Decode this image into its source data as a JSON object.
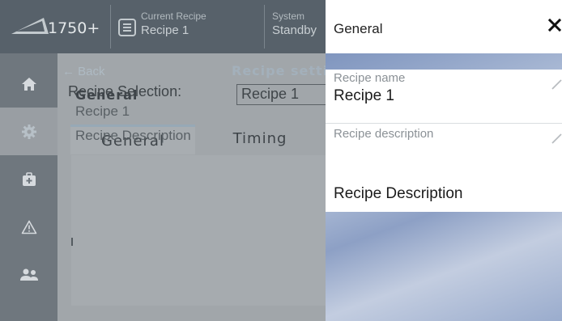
{
  "app": {
    "model": "1750+",
    "current_recipe_label": "Current Recipe",
    "current_recipe_value": "Recipe 1",
    "system_label": "System",
    "system_value": "Standby"
  },
  "sidebar": {
    "items": [
      {
        "icon": "home-icon",
        "active": false
      },
      {
        "icon": "gear-icon",
        "active": true
      },
      {
        "icon": "toolbox-icon",
        "active": false
      },
      {
        "icon": "warning-icon",
        "active": false
      },
      {
        "icon": "users-icon",
        "active": false
      }
    ]
  },
  "content": {
    "back_label": "Back",
    "page_heading": "Recipe settings",
    "recipe_selection_label": "Recipe Selection:",
    "recipe_selection_value": "Recipe 1",
    "tabs": [
      {
        "label": "General",
        "active": true
      },
      {
        "label": "Timing",
        "active": false
      }
    ],
    "card": {
      "title": "General",
      "name": "Recipe 1",
      "description": "Recipe Description"
    }
  },
  "panel": {
    "title": "General",
    "fields": [
      {
        "label": "Recipe name",
        "value": "Recipe 1"
      },
      {
        "label": "Recipe description",
        "value": "Recipe Description"
      }
    ]
  },
  "colors": {
    "topbar": "#57616a",
    "sidebar": "#6f777e",
    "content_bg": "#a1a6aa",
    "panel_header": "#ffffff",
    "panel_backdrop": "#8da1c6"
  }
}
